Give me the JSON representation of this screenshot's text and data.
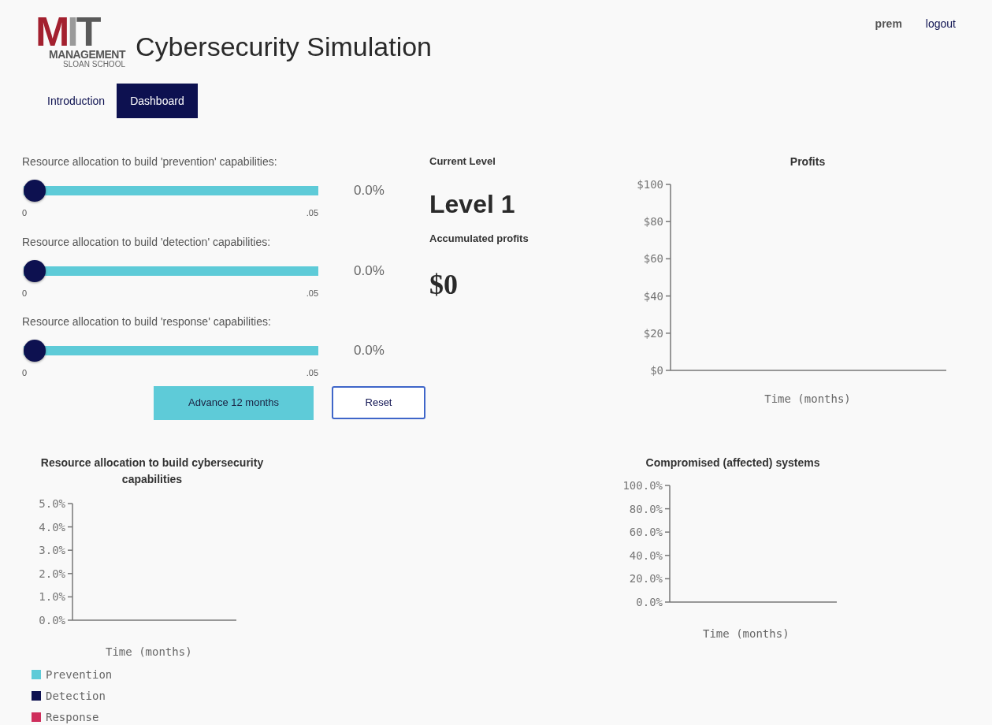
{
  "logo": {
    "letters": [
      "M",
      "I",
      "T"
    ],
    "line_1": "MANAGEMENT",
    "line_2": "SLOAN SCHOOL"
  },
  "title": "Cybersecurity Simulation",
  "user": {
    "name": "prem",
    "logout": "logout"
  },
  "tabs": [
    {
      "label": "Introduction",
      "selected": false
    },
    {
      "label": "Dashboard",
      "selected": true
    }
  ],
  "sliders": [
    {
      "label": "Resource allocation to build 'prevention' capabilities:",
      "level": 0,
      "min_label": "0",
      "max_label": ".05",
      "reading": "0.0%"
    },
    {
      "label": "Resource allocation to build 'detection' capabilities:",
      "level": 0,
      "min_label": "0",
      "max_label": ".05",
      "reading": "0.0%"
    },
    {
      "label": "Resource allocation to build 'response' capabilities:",
      "level": 0,
      "min_label": "0",
      "max_label": ".05",
      "reading": "0.0%"
    }
  ],
  "buttons": [
    {
      "label": "Advance 12 months",
      "kind": "primary"
    },
    {
      "label": "Reset",
      "kind": "outline"
    }
  ],
  "level_panel": {
    "heading": "Current Level",
    "level": "Level 1",
    "profits_heading": "Accumulated profits",
    "profits": "$0"
  },
  "profits_chart": {
    "chart_data": {
      "type": "line",
      "title": "Profits",
      "categories": [
        null
      ],
      "xlabel": "Time (months)",
      "ylim": [
        0,
        100
      ],
      "yticks": [
        {
          "value": 0,
          "label": "$0"
        },
        {
          "value": 20,
          "label": "$20"
        },
        {
          "value": 40,
          "label": "$40"
        },
        {
          "value": 60,
          "label": "$60"
        },
        {
          "value": 80,
          "label": "$80"
        },
        {
          "value": 100,
          "label": "$100"
        }
      ]
    }
  },
  "allocation_chart": {
    "chart_data": {
      "type": "line",
      "title": "Resource allocation to build cybersecurity capabilities",
      "xlabel": "Time (months)",
      "ylim": [
        0,
        0.05
      ],
      "yticks": [
        {
          "value": 0,
          "label": "0.0%"
        },
        {
          "value": 0.01,
          "label": "1.0%"
        },
        {
          "value": 0.02,
          "label": "2.0%"
        },
        {
          "value": 0.03,
          "label": "3.0%"
        },
        {
          "value": 0.04,
          "label": "4.0%"
        },
        {
          "value": 0.05,
          "label": "5.0%"
        }
      ],
      "series": [
        {
          "name": "Prevention",
          "color": "#5ecbd8"
        },
        {
          "name": "Detection",
          "color": "#0d1150"
        },
        {
          "name": "Response",
          "color": "#cf2e5c"
        }
      ]
    }
  },
  "compromised_chart": {
    "chart_data": {
      "type": "line",
      "title": "Compromised (affected) systems",
      "categories": [
        null
      ],
      "xlabel": "Time (months)",
      "ylim": [
        0,
        1
      ],
      "yticks": [
        {
          "value": 0,
          "label": "0.0%"
        },
        {
          "value": 0.2,
          "label": "20.0%"
        },
        {
          "value": 0.4,
          "label": "40.0%"
        },
        {
          "value": 0.6,
          "label": "60.0%"
        },
        {
          "value": 0.8,
          "label": "80.0%"
        },
        {
          "value": 1,
          "label": "100.0%"
        }
      ]
    }
  }
}
